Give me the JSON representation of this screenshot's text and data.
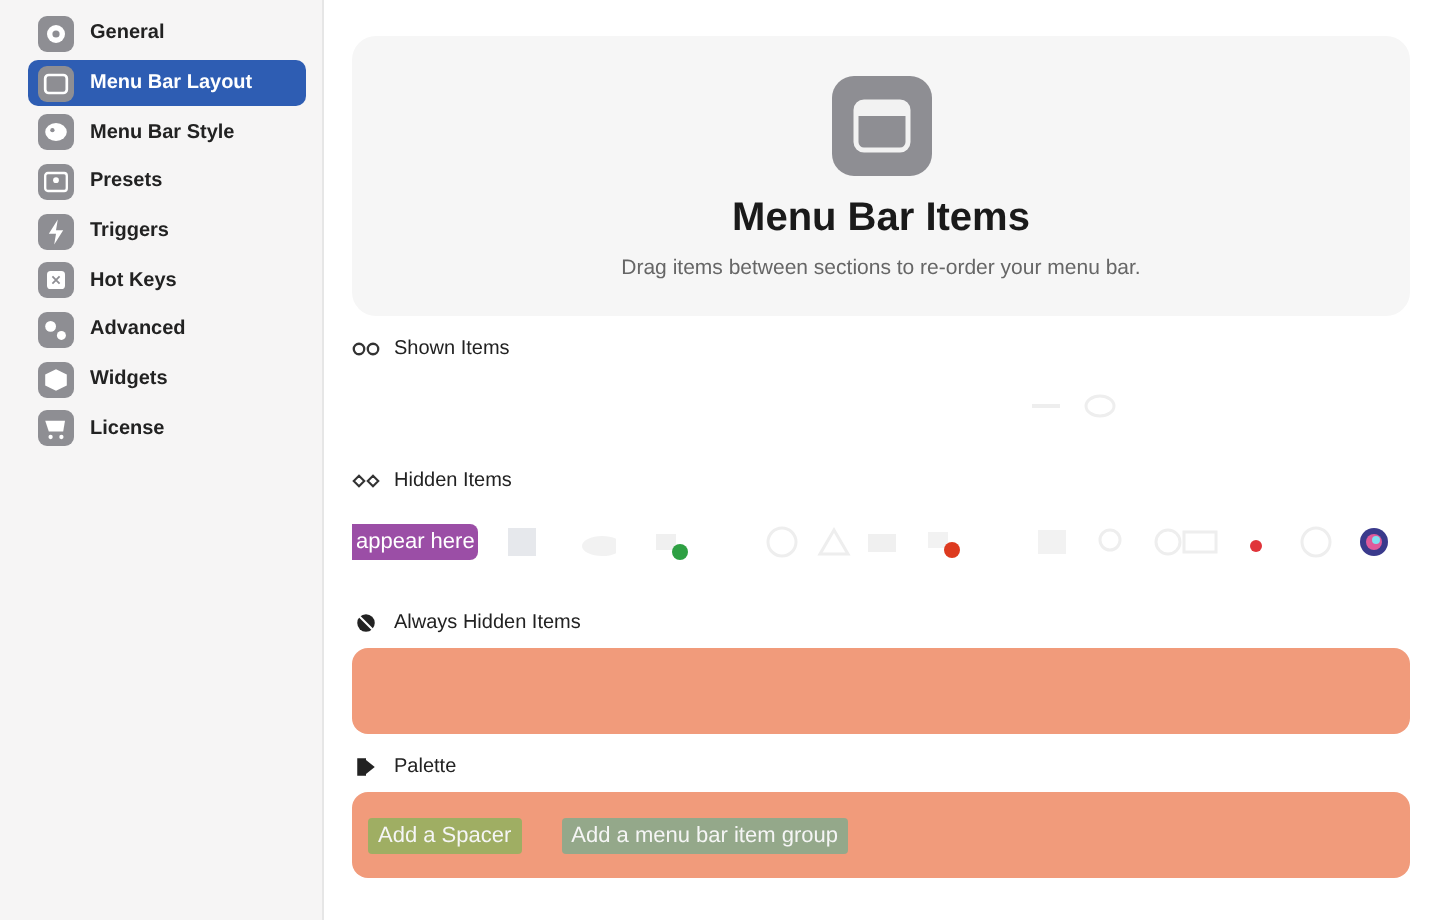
{
  "sidebar": {
    "items": [
      {
        "label": "General",
        "selected": false
      },
      {
        "label": "Menu Bar Layout",
        "selected": true
      },
      {
        "label": "Menu Bar Style",
        "selected": false
      },
      {
        "label": "Presets",
        "selected": false
      },
      {
        "label": "Triggers",
        "selected": false
      },
      {
        "label": "Hot Keys",
        "selected": false
      },
      {
        "label": "Advanced",
        "selected": false
      },
      {
        "label": "Widgets",
        "selected": false
      },
      {
        "label": "License",
        "selected": false
      }
    ]
  },
  "header": {
    "title": "Menu Bar Items",
    "subtitle": "Drag items between sections to re-order your menu bar."
  },
  "sections": [
    {
      "kind": "shown",
      "title": "Shown Items"
    },
    {
      "kind": "hidden",
      "title": "Hidden Items",
      "tooltip": "appear here"
    },
    {
      "kind": "always",
      "title": "Always Hidden Items"
    },
    {
      "kind": "palette",
      "title": "Palette",
      "buttons": [
        {
          "label": "Add a Spacer",
          "color": "#9fae63"
        },
        {
          "label": "Add a menu bar item group",
          "color": "#94a88a"
        }
      ]
    }
  ]
}
